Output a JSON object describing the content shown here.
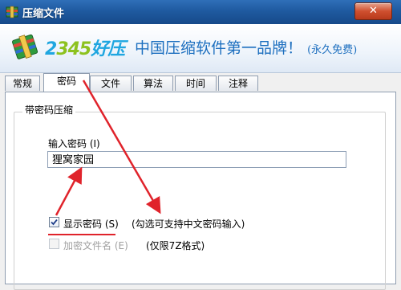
{
  "window": {
    "title": "压缩文件",
    "close_label": "✕"
  },
  "banner": {
    "logo_part1": "2",
    "logo_part2": "345",
    "logo_part3": "好压",
    "slogan": "中国压缩软件第一品牌！",
    "slogan_sub": "(永久免费)"
  },
  "tabs": [
    {
      "label": "常规",
      "active": false
    },
    {
      "label": "密码",
      "active": true
    },
    {
      "label": "文件",
      "active": false
    },
    {
      "label": "算法",
      "active": false
    },
    {
      "label": "时间",
      "active": false
    },
    {
      "label": "注释",
      "active": false
    }
  ],
  "password_group": {
    "title": "带密码压缩",
    "input_label": "输入密码 (I)",
    "input_value": "狸窝家园",
    "show_password": {
      "label": "显示密码 (S)",
      "checked": true
    },
    "show_password_note": "(勾选可支持中文密码输入)",
    "encrypt_filenames": {
      "label": "加密文件名 (E)",
      "checked": false,
      "disabled": true
    },
    "encrypt_filenames_note": "(仅限7Z格式)"
  },
  "colors": {
    "accent_blue": "#1d6fbf",
    "annotation_red": "#e0232b"
  }
}
